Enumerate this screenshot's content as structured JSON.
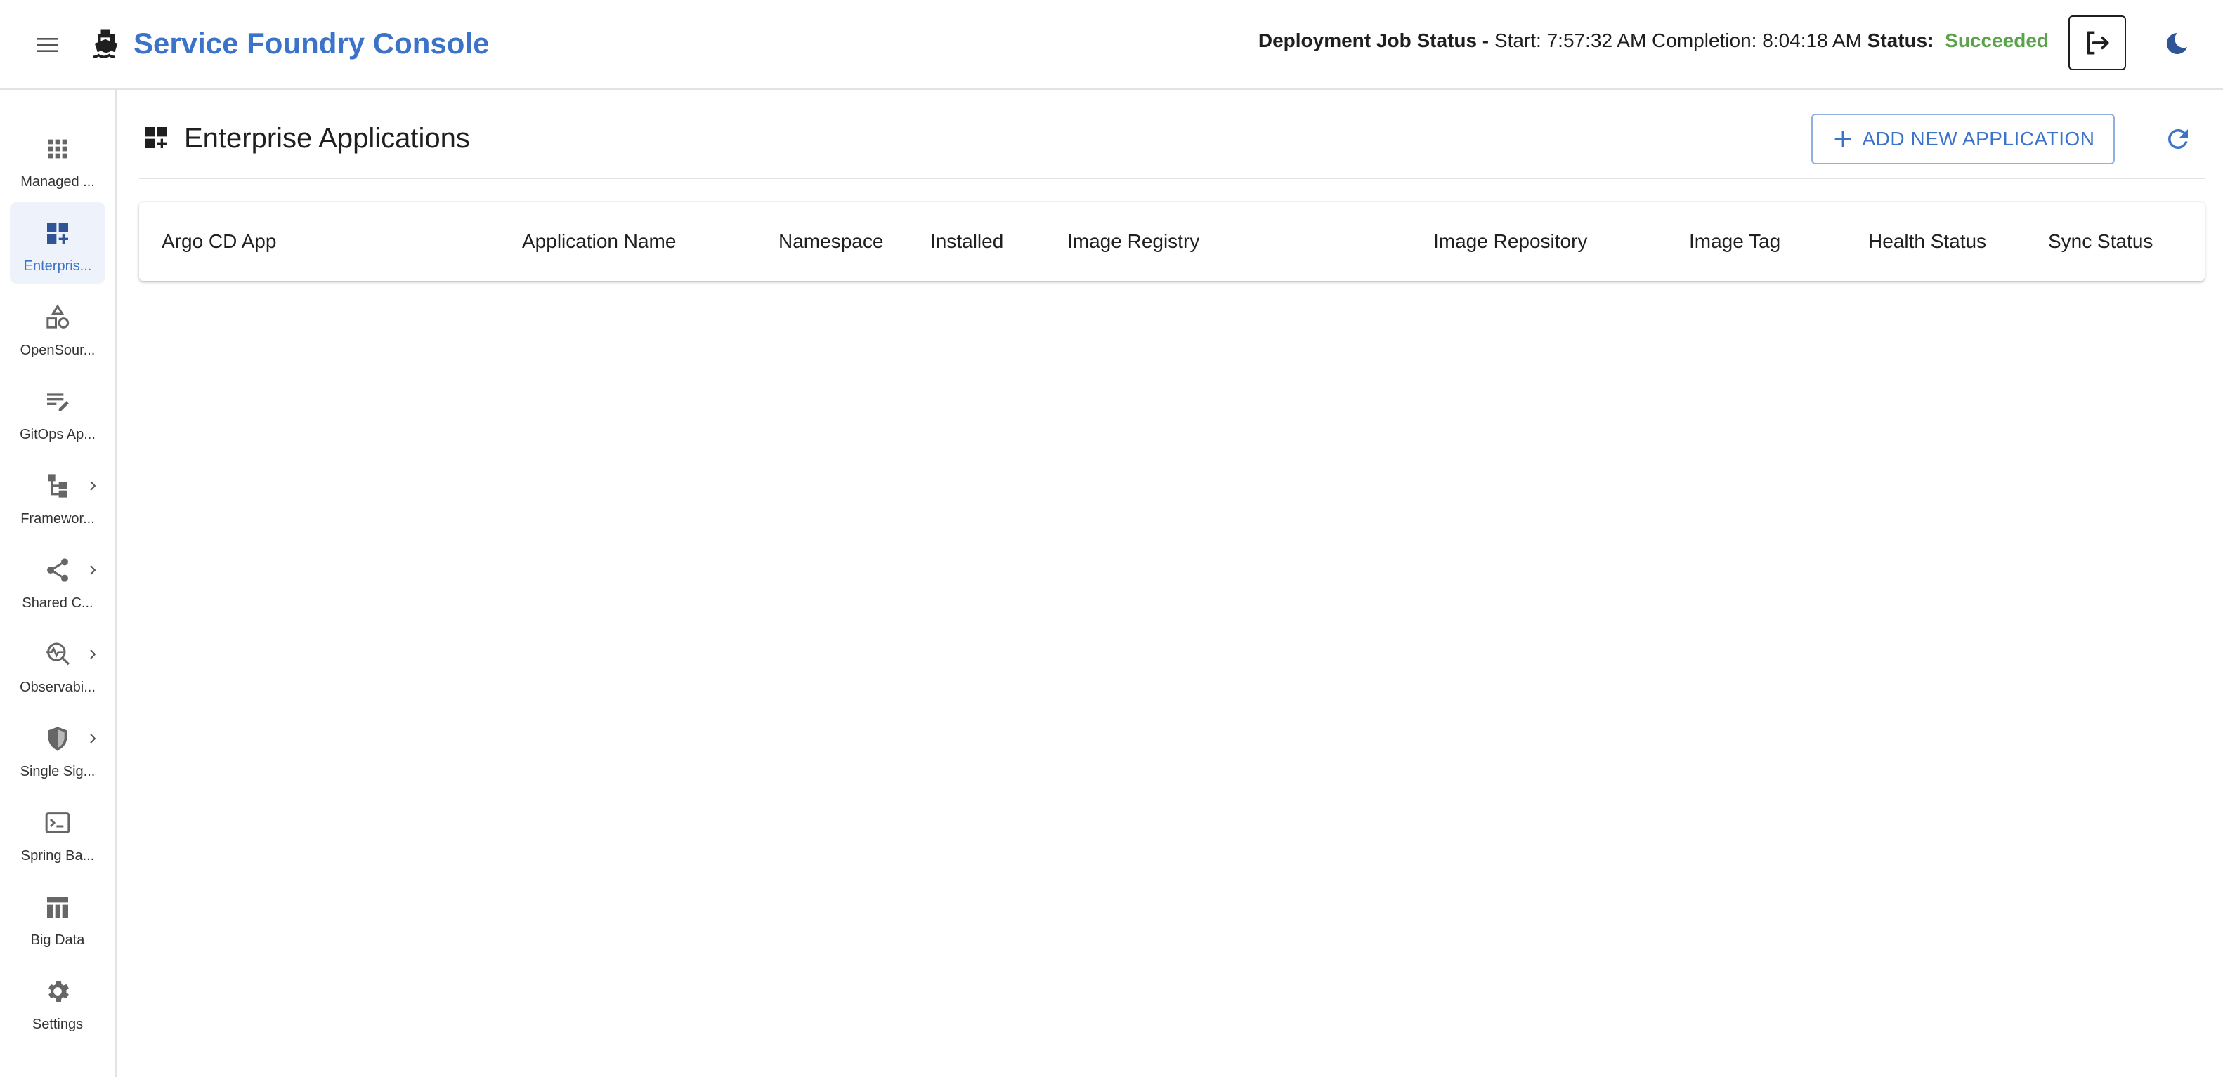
{
  "app": {
    "title": "Service Foundry Console"
  },
  "job_status": {
    "label": "Deployment Job Status -",
    "start_label": "Start:",
    "start_time": "7:57:32 AM",
    "completion_label": "Completion:",
    "completion_time": "8:04:18 AM",
    "status_label": "Status:",
    "status_value": "Succeeded",
    "status_color": "#5aa34a"
  },
  "colors": {
    "brand": "#3a73c8",
    "active_nav_bg": "#eef2fa"
  },
  "sidebar": {
    "items": [
      {
        "label": "Managed ...",
        "icon": "apps-grid-icon",
        "active": false,
        "has_submenu": false
      },
      {
        "label": "Enterpris...",
        "icon": "dashboard-add-icon",
        "active": true,
        "has_submenu": false
      },
      {
        "label": "OpenSour...",
        "icon": "shapes-icon",
        "active": false,
        "has_submenu": false
      },
      {
        "label": "GitOps Ap...",
        "icon": "edit-note-icon",
        "active": false,
        "has_submenu": false
      },
      {
        "label": "Framewor...",
        "icon": "account-tree-icon",
        "active": false,
        "has_submenu": true
      },
      {
        "label": "Shared C...",
        "icon": "share-icon",
        "active": false,
        "has_submenu": true
      },
      {
        "label": "Observabi...",
        "icon": "monitor-search-icon",
        "active": false,
        "has_submenu": true
      },
      {
        "label": "Single Sig...",
        "icon": "shield-icon",
        "active": false,
        "has_submenu": true
      },
      {
        "label": "Spring Ba...",
        "icon": "terminal-icon",
        "active": false,
        "has_submenu": false
      },
      {
        "label": "Big Data",
        "icon": "table-icon",
        "active": false,
        "has_submenu": false
      },
      {
        "label": "Settings",
        "icon": "gear-icon",
        "active": false,
        "has_submenu": false
      }
    ]
  },
  "main": {
    "title": "Enterprise Applications",
    "add_button_label": "ADD NEW APPLICATION",
    "table": {
      "columns": [
        "Argo CD App",
        "Application Name",
        "Namespace",
        "Installed",
        "Image Registry",
        "Image Repository",
        "Image Tag",
        "Health Status",
        "Sync Status"
      ],
      "rows": []
    }
  }
}
